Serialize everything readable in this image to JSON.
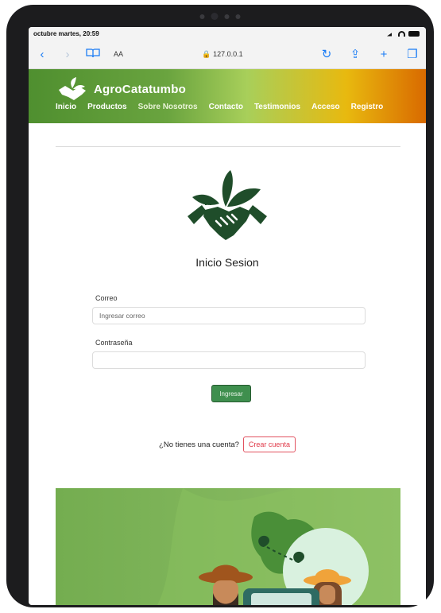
{
  "status_bar": {
    "time": "octubre martes, 20:59"
  },
  "browser": {
    "back_icon": "chevron-left-icon",
    "forward_icon": "chevron-right-icon",
    "reader_icon": "book-icon",
    "text_size": "AA",
    "url": "127.0.0.1",
    "reload_icon": "reload-icon",
    "share_icon": "share-icon",
    "new_tab_icon": "plus-icon",
    "tabs_icon": "tabs-icon"
  },
  "site": {
    "brand": "AgroCatatumbo",
    "nav": [
      "Inicio",
      "Productos",
      "Sobre Nosotros",
      "Contacto",
      "Testimonios",
      "Acceso",
      "Registro"
    ]
  },
  "login": {
    "title": "Inicio Sesion",
    "email_label": "Correo",
    "email_placeholder": "Ingresar correo",
    "password_label": "Contraseña",
    "submit_label": "Ingresar",
    "no_account_text": "¿No tienes una cuenta?",
    "create_account_label": "Crear cuenta"
  },
  "colors": {
    "header_green": "#4f8f2f",
    "header_orange": "#d96a00",
    "primary_button": "#3f8f4e",
    "danger_outline": "#e25260"
  }
}
